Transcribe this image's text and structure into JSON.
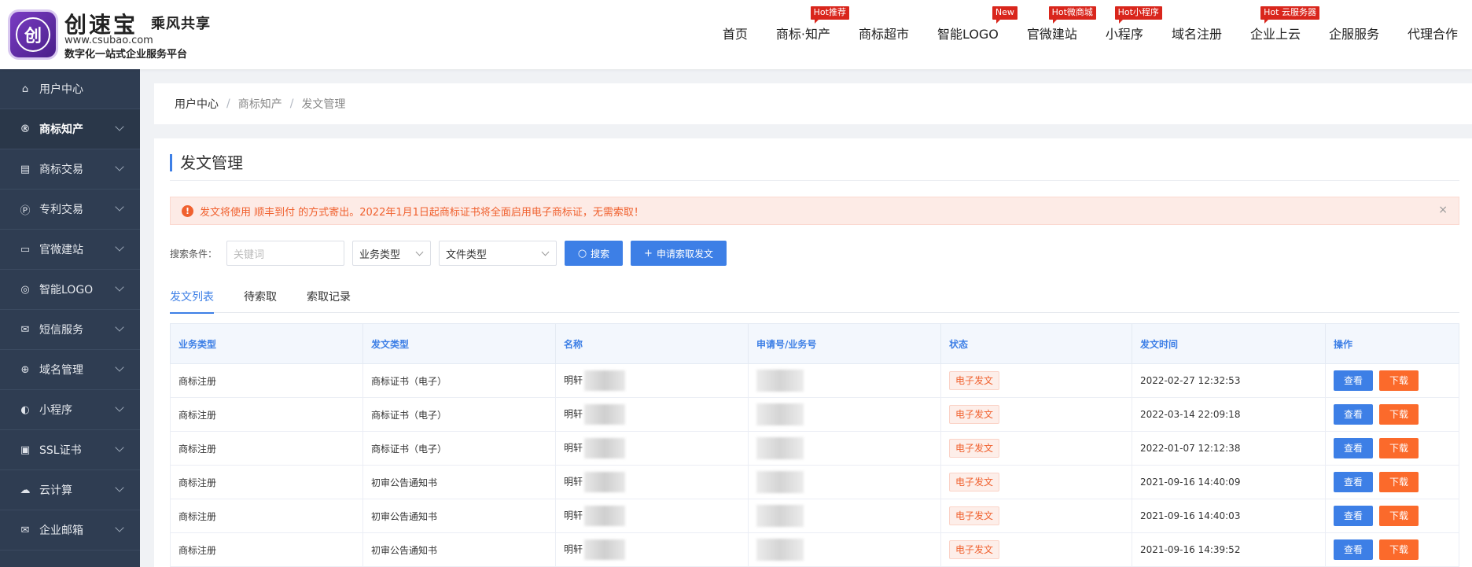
{
  "brand": {
    "logo_char": "创",
    "name": "创速宝",
    "name_2": "乘风共享",
    "url": "www.csubao.com",
    "slogan": "数字化一站式企业服务平台"
  },
  "nav": {
    "items": [
      {
        "label": "首页",
        "badge": ""
      },
      {
        "label": "商标·知产",
        "badge": "Hot推荐"
      },
      {
        "label": "商标超市",
        "badge": ""
      },
      {
        "label": "智能LOGO",
        "badge": "New"
      },
      {
        "label": "官微建站",
        "badge": "Hot微商城"
      },
      {
        "label": "小程序",
        "badge": "Hot小程序"
      },
      {
        "label": "域名注册",
        "badge": ""
      },
      {
        "label": "企业上云",
        "badge": "Hot 云服务器"
      },
      {
        "label": "企服服务",
        "badge": ""
      },
      {
        "label": "代理合作",
        "badge": ""
      }
    ]
  },
  "sidebar": {
    "items": [
      {
        "label": "用户中心",
        "icon": "home-icon"
      },
      {
        "label": "商标知产",
        "icon": "registered-icon"
      },
      {
        "label": "商标交易",
        "icon": "cart-icon"
      },
      {
        "label": "专利交易",
        "icon": "patent-icon"
      },
      {
        "label": "官微建站",
        "icon": "monitor-icon"
      },
      {
        "label": "智能LOGO",
        "icon": "logo-icon"
      },
      {
        "label": "短信服务",
        "icon": "mail-icon"
      },
      {
        "label": "域名管理",
        "icon": "globe-icon"
      },
      {
        "label": "小程序",
        "icon": "miniapp-icon"
      },
      {
        "label": "SSL证书",
        "icon": "lock-icon"
      },
      {
        "label": "云计算",
        "icon": "cloud-icon"
      },
      {
        "label": "企业邮箱",
        "icon": "envelope-icon"
      }
    ]
  },
  "breadcrumb": {
    "items": [
      "用户中心",
      "商标知产",
      "发文管理"
    ],
    "separator": "/"
  },
  "page": {
    "title": "发文管理",
    "alert_text": "发文将使用 顺丰到付 的方式寄出。2022年1月1日起商标证书将全面启用电子商标证，无需索取！",
    "close_glyph": "×"
  },
  "search": {
    "label": "搜索条件：",
    "keyword_placeholder": "关键词",
    "business_type": "业务类型",
    "file_type": "文件类型",
    "search_button": "搜索",
    "apply_button": "申请索取发文"
  },
  "tabs": [
    {
      "label": "发文列表",
      "active": true
    },
    {
      "label": "待索取",
      "active": false
    },
    {
      "label": "索取记录",
      "active": false
    }
  ],
  "table": {
    "headers": [
      "业务类型",
      "发文类型",
      "名称",
      "申请号/业务号",
      "状态",
      "发文时间",
      "操作"
    ],
    "view_label": "查看",
    "download_label": "下载",
    "rows": [
      {
        "business": "商标注册",
        "doc_type": "商标证书（电子）",
        "name_prefix": "明轩",
        "status": "电子发文",
        "time": "2022-02-27 12:32:53"
      },
      {
        "business": "商标注册",
        "doc_type": "商标证书（电子）",
        "name_prefix": "明轩",
        "status": "电子发文",
        "time": "2022-03-14 22:09:18"
      },
      {
        "business": "商标注册",
        "doc_type": "商标证书（电子）",
        "name_prefix": "明轩",
        "status": "电子发文",
        "time": "2022-01-07 12:12:38"
      },
      {
        "business": "商标注册",
        "doc_type": "初审公告通知书",
        "name_prefix": "明轩",
        "status": "电子发文",
        "time": "2021-09-16 14:40:09"
      },
      {
        "business": "商标注册",
        "doc_type": "初审公告通知书",
        "name_prefix": "明轩",
        "status": "电子发文",
        "time": "2021-09-16 14:40:03"
      },
      {
        "business": "商标注册",
        "doc_type": "初审公告通知书",
        "name_prefix": "明轩",
        "status": "电子发文",
        "time": "2021-09-16 14:39:52"
      }
    ]
  },
  "colors": {
    "accent": "#3d7fe6",
    "sidebar_bg": "#2f3d52",
    "download": "#fb6a2b",
    "alert_text": "#f0612f",
    "badge": "#d9261c"
  }
}
